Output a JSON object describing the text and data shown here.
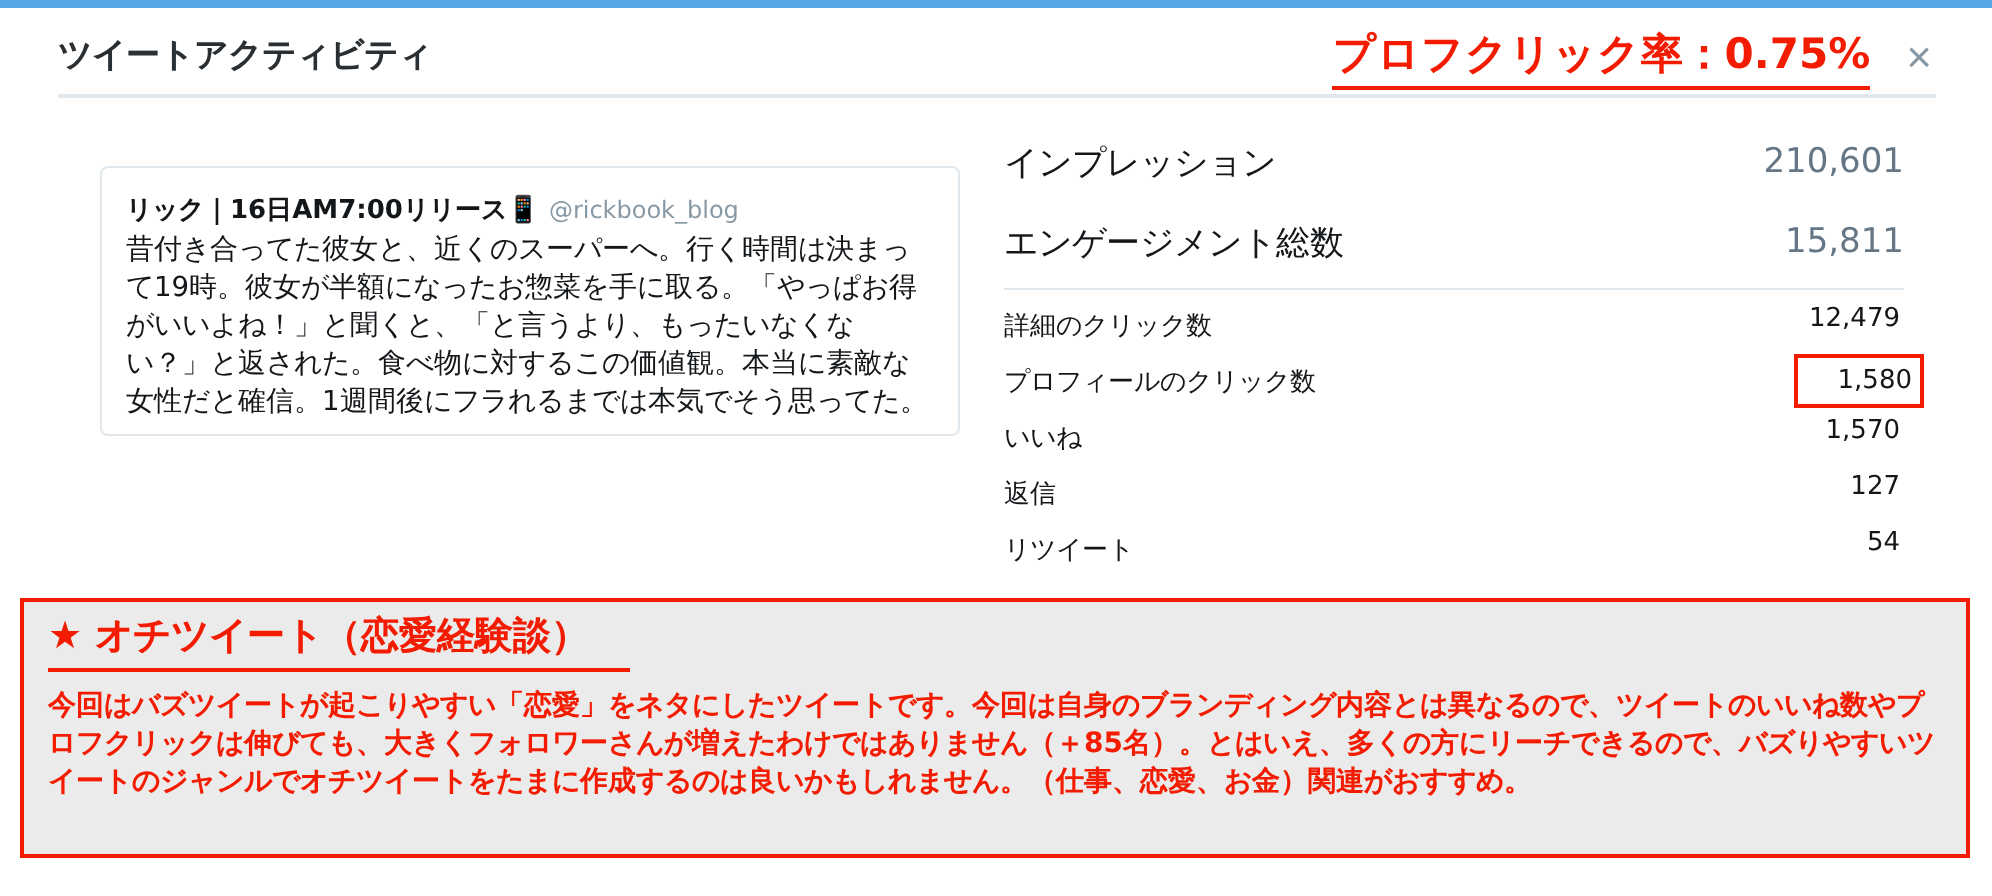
{
  "header": {
    "title": "ツイートアクティビティ",
    "rate": "プロフクリック率：0.75%",
    "close": "×"
  },
  "tweet": {
    "author": "リック｜16日AM7:00リリース📱",
    "handle": "@rickbook_blog",
    "text": "昔付き合ってた彼女と、近くのスーパーへ。行く時間は決まって19時。彼女が半額になったお惣菜を手に取る。「やっぱお得がいいよね！」と聞くと、「と言うより、もったいなくない？」と返された。食べ物に対するこの価値観。本当に素敵な女性だと確信。1週間後にフラれるまでは本気でそう思ってた。"
  },
  "summary": [
    {
      "label": "インプレッション",
      "value": "210,601"
    },
    {
      "label": "エンゲージメント総数",
      "value": "15,811"
    }
  ],
  "metrics": [
    {
      "label": "詳細のクリック数",
      "value": "12,479",
      "highlighted": false
    },
    {
      "label": "プロフィールのクリック数",
      "value": "1,580",
      "highlighted": true
    },
    {
      "label": "いいね",
      "value": "1,570",
      "highlighted": false
    },
    {
      "label": "返信",
      "value": "127",
      "highlighted": false
    },
    {
      "label": "リツイート",
      "value": "54",
      "highlighted": false
    }
  ],
  "note": {
    "title": "★ オチツイート（恋愛経験談）",
    "text": "今回はバズツイートが起こりやすい「恋愛」をネタにしたツイートです。今回は自身のブランディング内容とは異なるので、ツイートのいいね数やプロフクリックは伸びても、大きくフォロワーさんが増えたわけではありません（＋85名）。とはいえ、多くの方にリーチできるので、バズりやすいツイートのジャンルでオチツイートをたまに作成するのは良いかもしれません。（仕事、恋愛、お金）関連がおすすめ。"
  }
}
